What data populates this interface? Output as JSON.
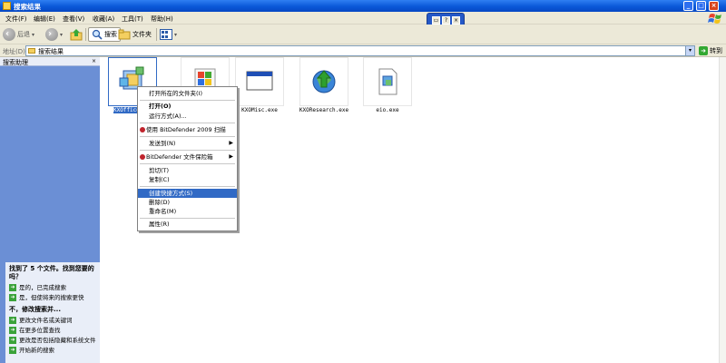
{
  "window": {
    "title": "搜索结果"
  },
  "menubar": {
    "items": [
      "文件(F)",
      "编辑(E)",
      "查看(V)",
      "收藏(A)",
      "工具(T)",
      "帮助(H)"
    ]
  },
  "toolbar": {
    "back_label": "后退",
    "search_label": "搜索",
    "folders_label": "文件夹"
  },
  "address": {
    "label": "地址(D)",
    "value": "搜索结果",
    "go_label": "转到"
  },
  "left_pane": {
    "title": "搜索助理",
    "heading": "找到了 5 个文件。找到您要的吗？",
    "items": [
      {
        "label": "是的，已完成搜索"
      },
      {
        "label": "是，但使将来的搜索更快"
      }
    ],
    "refine_heading": "不，修改搜索并...",
    "refine_items": [
      {
        "label": "更改文件名或关键词"
      },
      {
        "label": "在更多位置查找"
      },
      {
        "label": "更改是否包括隐藏和系统文件"
      },
      {
        "label": "开始新的搜索"
      }
    ]
  },
  "files": [
    {
      "name": "KXOffice",
      "icon": "app-setup-icon",
      "selected": true
    },
    {
      "name": "",
      "icon": "installer-icon",
      "selected": false
    },
    {
      "name": "KXOMisc.exe",
      "icon": "window-app-icon",
      "selected": false
    },
    {
      "name": "KXOResearch.exe",
      "icon": "globe-arrow-icon",
      "selected": false
    },
    {
      "name": "eio.exe",
      "icon": "exe-file-icon",
      "selected": false
    }
  ],
  "context_menu": {
    "items": [
      {
        "label": "打开所在的文件夹(I)",
        "type": "item"
      },
      {
        "type": "sep"
      },
      {
        "label": "打开(O)",
        "type": "item",
        "bold": true
      },
      {
        "label": "运行方式(A)...",
        "type": "item"
      },
      {
        "type": "sep"
      },
      {
        "label": "使用 BitDefender 2009 扫描",
        "type": "item",
        "icon": "bitdefender-icon"
      },
      {
        "type": "sep"
      },
      {
        "label": "发送到(N)",
        "type": "item",
        "submenu": true
      },
      {
        "type": "sep"
      },
      {
        "label": "BitDefender 文件保险箱",
        "type": "item",
        "icon": "bitdefender-icon",
        "submenu": true
      },
      {
        "type": "sep"
      },
      {
        "label": "剪切(T)",
        "type": "item"
      },
      {
        "label": "复制(C)",
        "type": "item"
      },
      {
        "type": "sep"
      },
      {
        "label": "创建快捷方式(S)",
        "type": "item",
        "highlight": true
      },
      {
        "label": "删除(D)",
        "type": "item"
      },
      {
        "label": "重命名(M)",
        "type": "item"
      },
      {
        "type": "sep"
      },
      {
        "label": "属性(R)",
        "type": "item"
      }
    ]
  },
  "colors": {
    "titlebar": "#0a58d8",
    "menu_highlight": "#316ac5",
    "task_pane": "#6b8fd5"
  }
}
